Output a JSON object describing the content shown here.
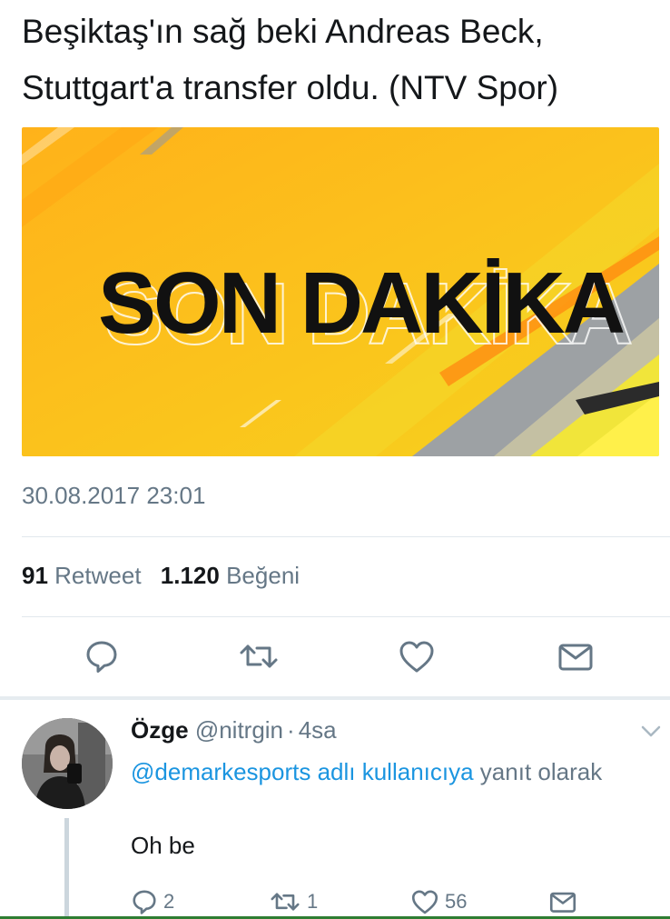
{
  "tweet": {
    "text": "Beşiktaş'ın sağ beki Andreas Beck, Stuttgart'a transfer oldu. (NTV Spor)",
    "media_caption": "SON DAKİKA",
    "timestamp": "30.08.2017 23:01",
    "retweet_count": "91",
    "retweet_label": "Retweet",
    "like_count": "1.120",
    "like_label": "Beğeni"
  },
  "actions": [
    {
      "icon": "reply-icon"
    },
    {
      "icon": "retweet-icon"
    },
    {
      "icon": "like-icon"
    },
    {
      "icon": "direct-message-icon"
    }
  ],
  "reply": {
    "name": "Özge",
    "handle": "@nitrgin",
    "separator": "·",
    "time": "4sa",
    "replying_mention": "@demarkesports adlı kullanıcıya",
    "replying_suffix": "yanıt olarak",
    "body": "Oh be",
    "reply_count": "2",
    "retweet_count": "1",
    "like_count": "56"
  },
  "colors": {
    "banner_yellow": "#FBBE1A",
    "accent_blue": "#1b95e0",
    "muted_gray": "#657786"
  }
}
